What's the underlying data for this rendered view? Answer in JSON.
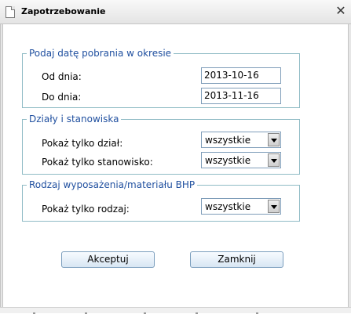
{
  "window": {
    "title": "Zapotrzebowanie",
    "close_glyph": "✕",
    "icon": "document-icon"
  },
  "date_group": {
    "legend": "Podaj datę pobrania w okresie",
    "from_label": "Od dnia:",
    "from_value": "2013-10-16",
    "to_label": "Do dnia:",
    "to_value": "2013-11-16"
  },
  "dept_group": {
    "legend": "Działy i stanowiska",
    "dept_label": "Pokaż tylko dział:",
    "dept_value": "wszystkie",
    "position_label": "Pokaż tylko stanowisko:",
    "position_value": "wszystkie"
  },
  "type_group": {
    "legend": "Rodzaj wyposażenia/materiału BHP",
    "type_label": "Pokaż tylko rodzaj:",
    "type_value": "wszystkie"
  },
  "buttons": {
    "accept": "Akceptuj",
    "close": "Zamknij"
  }
}
